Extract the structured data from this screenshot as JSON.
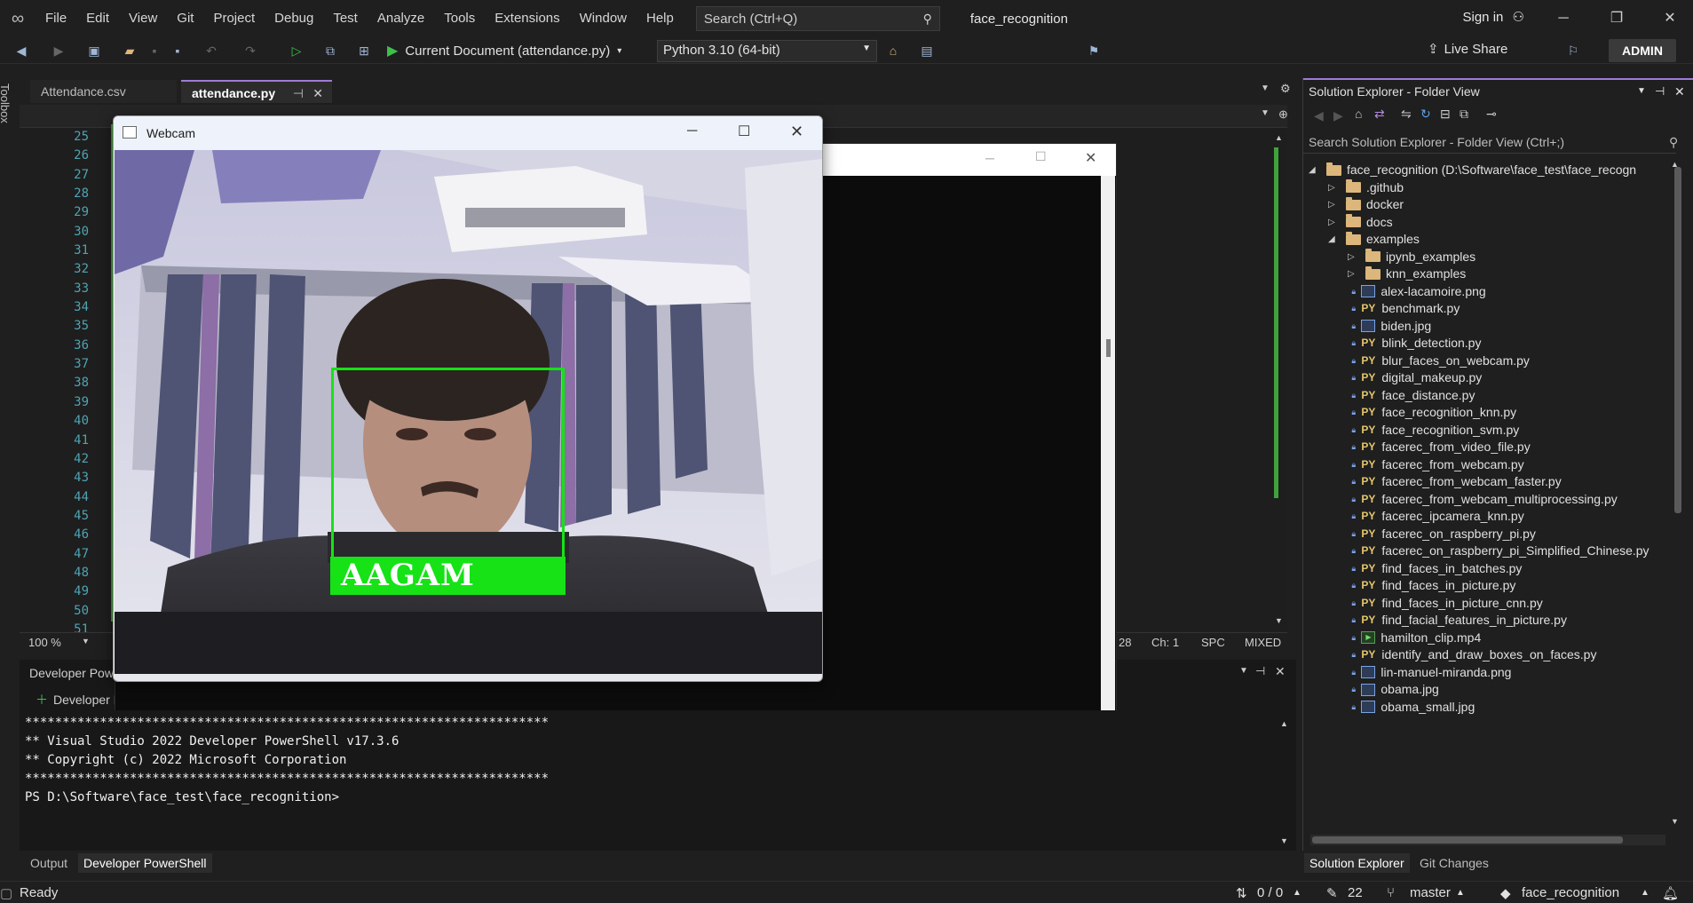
{
  "menu": {
    "items": [
      "File",
      "Edit",
      "View",
      "Git",
      "Project",
      "Debug",
      "Test",
      "Analyze",
      "Tools",
      "Extensions",
      "Window",
      "Help"
    ],
    "search_placeholder": "Search (Ctrl+Q)",
    "solution_name": "face_recognition",
    "sign_in": "Sign in"
  },
  "toolbar": {
    "run_target": "Current Document (attendance.py)",
    "interpreter": "Python 3.10 (64-bit)",
    "live_share": "Live Share",
    "user_badge": "ADMIN"
  },
  "toolbox_label": "Toolbox",
  "tabs": [
    {
      "label": "Attendance.csv",
      "active": false
    },
    {
      "label": "attendance.py",
      "active": true
    }
  ],
  "editor": {
    "line_numbers": [
      "25",
      "26",
      "27",
      "28",
      "29",
      "30",
      "31",
      "32",
      "33",
      "34",
      "35",
      "36",
      "37",
      "38",
      "39",
      "40",
      "41",
      "42",
      "43",
      "44",
      "45",
      "46",
      "47",
      "48",
      "49",
      "50",
      "51"
    ],
    "zoom": "100 %",
    "cursor_col": "28",
    "cursor_ch": "Ch: 1",
    "indent_mode": "SPC",
    "line_endings": "MIXED"
  },
  "terminal": {
    "panel_title": "Developer PowerShell",
    "new_terminal_label": "Developer PowerShell",
    "output_lines": [
      "**********************************************************************",
      "** Visual Studio 2022 Developer PowerShell v17.3.6",
      "** Copyright (c) 2022 Microsoft Corporation",
      "**********************************************************************",
      "PS D:\\Software\\face_test\\face_recognition>"
    ]
  },
  "bottom_tabs": [
    "Output",
    "Developer PowerShell"
  ],
  "solution_explorer": {
    "title": "Solution Explorer - Folder View",
    "search_placeholder": "Search Solution Explorer - Folder View (Ctrl+;)",
    "root": "face_recognition (D:\\Software\\face_test\\face_recogn",
    "items": [
      {
        "name": ".github",
        "kind": "folder",
        "depth": 1,
        "expanded": false
      },
      {
        "name": "docker",
        "kind": "folder",
        "depth": 1,
        "expanded": false
      },
      {
        "name": "docs",
        "kind": "folder",
        "depth": 1,
        "expanded": false
      },
      {
        "name": "examples",
        "kind": "folder",
        "depth": 1,
        "expanded": true
      },
      {
        "name": "ipynb_examples",
        "kind": "folder",
        "depth": 2,
        "expanded": false
      },
      {
        "name": "knn_examples",
        "kind": "folder",
        "depth": 2,
        "expanded": false
      },
      {
        "name": "alex-lacamoire.png",
        "kind": "image",
        "depth": 2
      },
      {
        "name": "benchmark.py",
        "kind": "py",
        "depth": 2
      },
      {
        "name": "biden.jpg",
        "kind": "image",
        "depth": 2
      },
      {
        "name": "blink_detection.py",
        "kind": "py",
        "depth": 2
      },
      {
        "name": "blur_faces_on_webcam.py",
        "kind": "py",
        "depth": 2
      },
      {
        "name": "digital_makeup.py",
        "kind": "py",
        "depth": 2
      },
      {
        "name": "face_distance.py",
        "kind": "py",
        "depth": 2
      },
      {
        "name": "face_recognition_knn.py",
        "kind": "py",
        "depth": 2
      },
      {
        "name": "face_recognition_svm.py",
        "kind": "py",
        "depth": 2
      },
      {
        "name": "facerec_from_video_file.py",
        "kind": "py",
        "depth": 2
      },
      {
        "name": "facerec_from_webcam.py",
        "kind": "py",
        "depth": 2
      },
      {
        "name": "facerec_from_webcam_faster.py",
        "kind": "py",
        "depth": 2
      },
      {
        "name": "facerec_from_webcam_multiprocessing.py",
        "kind": "py",
        "depth": 2
      },
      {
        "name": "facerec_ipcamera_knn.py",
        "kind": "py",
        "depth": 2
      },
      {
        "name": "facerec_on_raspberry_pi.py",
        "kind": "py",
        "depth": 2
      },
      {
        "name": "facerec_on_raspberry_pi_Simplified_Chinese.py",
        "kind": "py",
        "depth": 2
      },
      {
        "name": "find_faces_in_batches.py",
        "kind": "py",
        "depth": 2
      },
      {
        "name": "find_faces_in_picture.py",
        "kind": "py",
        "depth": 2
      },
      {
        "name": "find_faces_in_picture_cnn.py",
        "kind": "py",
        "depth": 2
      },
      {
        "name": "find_facial_features_in_picture.py",
        "kind": "py",
        "depth": 2
      },
      {
        "name": "hamilton_clip.mp4",
        "kind": "video",
        "depth": 2
      },
      {
        "name": "identify_and_draw_boxes_on_faces.py",
        "kind": "py",
        "depth": 2
      },
      {
        "name": "lin-manuel-miranda.png",
        "kind": "image",
        "depth": 2
      },
      {
        "name": "obama.jpg",
        "kind": "image",
        "depth": 2
      },
      {
        "name": "obama_small.jpg",
        "kind": "image",
        "depth": 2
      }
    ],
    "bottom_tabs": [
      "Solution Explorer",
      "Git Changes"
    ]
  },
  "webcam_window": {
    "title": "Webcam",
    "detected_name": "AAGAM"
  },
  "statusbar": {
    "ready": "Ready",
    "git_counts": "0 / 0",
    "pending_edits": "22",
    "branch": "master",
    "repo": "face_recognition"
  },
  "colors": {
    "accent": "#9e7bd6",
    "detection_box": "#16e216",
    "change_bar": "#3fa33b",
    "line_number": "#4fa3b2"
  }
}
